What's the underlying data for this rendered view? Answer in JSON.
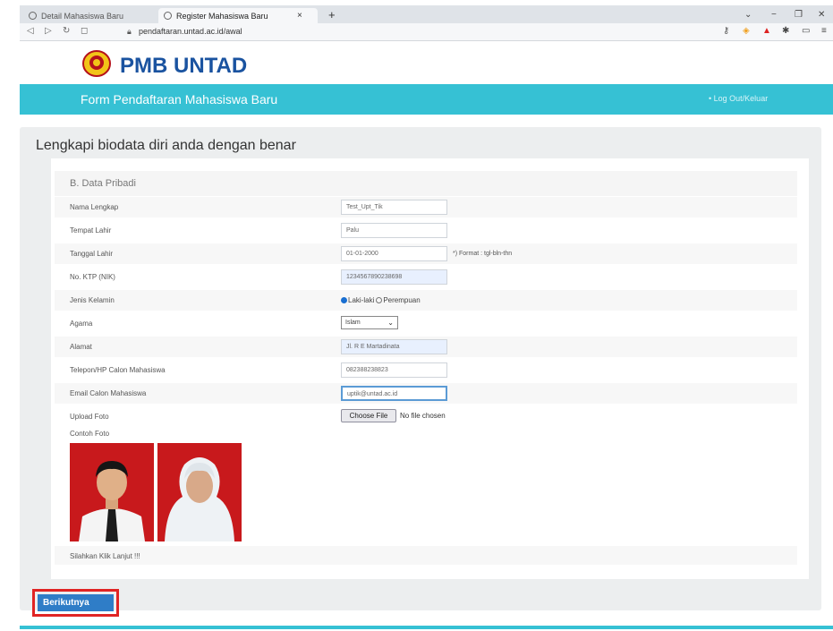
{
  "browser": {
    "tabs": [
      {
        "label": "Detail Mahasiswa Baru"
      },
      {
        "label": "Register Mahasiswa Baru"
      }
    ],
    "new_tab": "+",
    "close": "×",
    "url": "pendaftaran.untad.ac.id/awal"
  },
  "site": {
    "title": "PMB UNTAD",
    "nav_title": "Form Pendaftaran Mahasiswa Baru",
    "logout": "• Log Out/Keluar"
  },
  "page": {
    "heading": "Lengkapi biodata diri anda dengan benar",
    "section": "B. Data Pribadi",
    "fields": {
      "nama": {
        "label": "Nama Lengkap",
        "value": "Test_Upt_Tik"
      },
      "tempat": {
        "label": "Tempat Lahir",
        "value": "Palu"
      },
      "tanggal": {
        "label": "Tanggal Lahir",
        "value": "01-01-2000",
        "hint": "*) Format : tgl-bln-thn"
      },
      "ktp": {
        "label": "No. KTP (NIK)",
        "value": "1234567890238698"
      },
      "jk": {
        "label": "Jenis Kelamin",
        "opt1": "Laki-laki",
        "opt2": "Perempuan"
      },
      "agama": {
        "label": "Agama",
        "value": "Islam"
      },
      "alamat": {
        "label": "Alamat",
        "value": "Jl. R E Martadinata"
      },
      "telepon": {
        "label": "Telepon/HP Calon Mahasiswa",
        "value": "082388238823"
      },
      "email": {
        "label": "Email Calon Mahasiswa",
        "value": "uptik@untad.ac.id"
      },
      "foto": {
        "label": "Upload Foto",
        "button": "Choose File",
        "status": "No file chosen"
      }
    },
    "contoh_foto": "Contoh Foto",
    "lanjut": "Silahkan Klik Lanjut !!!",
    "next_button": "Berikutnya"
  },
  "colors": {
    "navbar": "#36c1d4",
    "title": "#1a53a0",
    "button": "#2f7dc7",
    "highlight": "#e02424"
  }
}
